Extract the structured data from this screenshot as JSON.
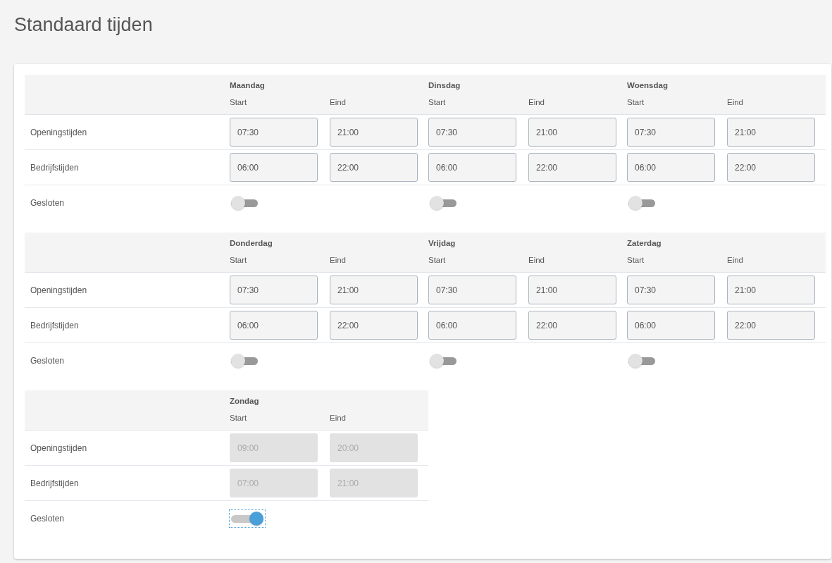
{
  "title": "Standaard tijden",
  "sections": [
    {
      "row_labels": {
        "opening": "Openingstijden",
        "business": "Bedrijfstijden",
        "closed": "Gesloten"
      },
      "days": [
        {
          "name": "Maandag",
          "start_label": "Start",
          "end_label": "Eind",
          "opening": {
            "start": "07:30",
            "end": "21:00"
          },
          "business": {
            "start": "06:00",
            "end": "22:00"
          },
          "closed": false,
          "focused": false
        },
        {
          "name": "Dinsdag",
          "start_label": "Start",
          "end_label": "Eind",
          "opening": {
            "start": "07:30",
            "end": "21:00"
          },
          "business": {
            "start": "06:00",
            "end": "22:00"
          },
          "closed": false,
          "focused": false
        },
        {
          "name": "Woensdag",
          "start_label": "Start",
          "end_label": "Eind",
          "opening": {
            "start": "07:30",
            "end": "21:00"
          },
          "business": {
            "start": "06:00",
            "end": "22:00"
          },
          "closed": false,
          "focused": false
        }
      ]
    },
    {
      "row_labels": {
        "opening": "Openingstijden",
        "business": "Bedrijfstijden",
        "closed": "Gesloten"
      },
      "days": [
        {
          "name": "Donderdag",
          "start_label": "Start",
          "end_label": "Eind",
          "opening": {
            "start": "07:30",
            "end": "21:00"
          },
          "business": {
            "start": "06:00",
            "end": "22:00"
          },
          "closed": false,
          "focused": false
        },
        {
          "name": "Vrijdag",
          "start_label": "Start",
          "end_label": "Eind",
          "opening": {
            "start": "07:30",
            "end": "21:00"
          },
          "business": {
            "start": "06:00",
            "end": "22:00"
          },
          "closed": false,
          "focused": false
        },
        {
          "name": "Zaterdag",
          "start_label": "Start",
          "end_label": "Eind",
          "opening": {
            "start": "07:30",
            "end": "21:00"
          },
          "business": {
            "start": "06:00",
            "end": "22:00"
          },
          "closed": false,
          "focused": false
        }
      ]
    },
    {
      "row_labels": {
        "opening": "Openingstijden",
        "business": "Bedrijfstijden",
        "closed": "Gesloten"
      },
      "days": [
        {
          "name": "Zondag",
          "start_label": "Start",
          "end_label": "Eind",
          "opening": {
            "start": "09:00",
            "end": "20:00"
          },
          "business": {
            "start": "07:00",
            "end": "21:00"
          },
          "closed": true,
          "focused": true
        }
      ]
    }
  ]
}
